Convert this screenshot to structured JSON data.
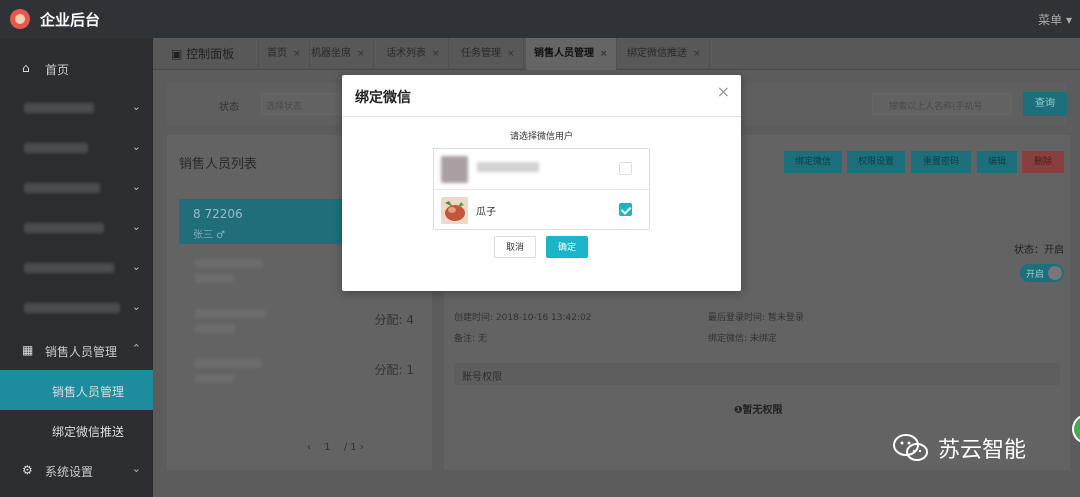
{
  "app": {
    "title": "企业后台",
    "menu_label": "菜单 ▾"
  },
  "sidebar": {
    "home": "首页",
    "sales_group": "销售人员管理",
    "sales_manage": "销售人员管理",
    "wechat_push": "绑定微信推送",
    "system": "系统设置"
  },
  "tabs": [
    {
      "label": "控制面板"
    },
    {
      "label": "首页"
    },
    {
      "label": "机器坐席"
    },
    {
      "label": "话术列表"
    },
    {
      "label": "任务管理"
    },
    {
      "label": "销售人员管理"
    },
    {
      "label": "绑定微信推送"
    }
  ],
  "filter": {
    "status_label": "状态",
    "status_placeholder": "选择状态",
    "search_placeholder": "搜索以上人名称(手机号",
    "search_button": "查询"
  },
  "left_panel": {
    "title": "销售人员列表",
    "selected_phone": "8      72206",
    "selected_sub": "张三  ♂",
    "row3_alloc": "分配: 4",
    "row4_alloc": "分配: 1",
    "page_current": "1",
    "page_total": "/ 1"
  },
  "right_panel": {
    "buttons": [
      "绑定微信",
      "权限设置",
      "重置密码",
      "编辑",
      "删除"
    ],
    "status_text": "状态：开启",
    "toggle_label": "开启",
    "created_label": "创建时间: 2018-10-16 13:42:02",
    "remark_label": "备注: 无",
    "last_login_label": "最后登录时间: 暂未登录",
    "wechat_bind_label": "绑定微信: 未绑定",
    "section_title": "账号权限",
    "no_permission": "❶暂无权限"
  },
  "modal": {
    "title": "绑定微信",
    "close": "×",
    "prompt": "请选择微信用户",
    "users": [
      {
        "name": "",
        "checked": false
      },
      {
        "name": "瓜子",
        "checked": true
      }
    ],
    "cancel": "取消",
    "confirm": "确定"
  },
  "watermark": {
    "text": "苏云智能"
  },
  "colors": {
    "accent": "#1bb5c9",
    "sidebar_active": "#1d8c9c",
    "topbar": "#2f3338"
  }
}
